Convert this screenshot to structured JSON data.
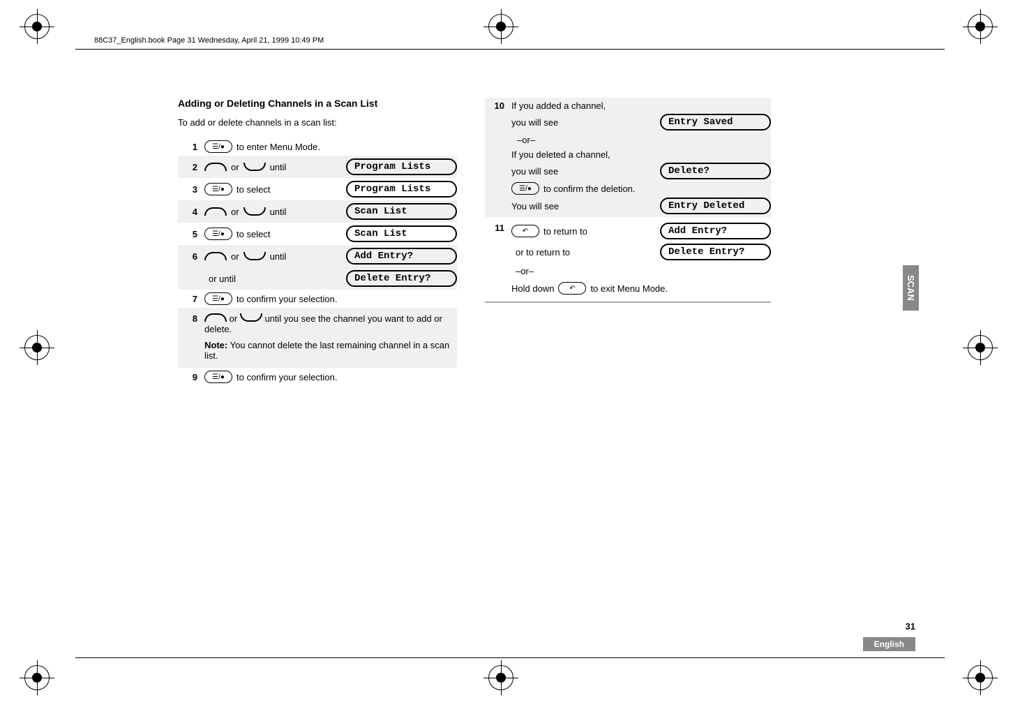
{
  "header": "88C37_English.book  Page 31  Wednesday, April 21, 1999  10:49 PM",
  "section": {
    "title": "Adding or Deleting Channels in a Scan List",
    "intro": "To add or delete channels in a scan list:"
  },
  "left_steps": {
    "s1": {
      "num": "1",
      "text": "to enter Menu Mode."
    },
    "s2": {
      "num": "2",
      "text_mid": "or",
      "text_until": "until",
      "display": "Program Lists"
    },
    "s3": {
      "num": "3",
      "text": "to select",
      "display": "Program Lists"
    },
    "s4": {
      "num": "4",
      "text_mid": "or",
      "text_until": "until",
      "display": "Scan List"
    },
    "s5": {
      "num": "5",
      "text": "to select",
      "display": "Scan List"
    },
    "s6": {
      "num": "6",
      "text_mid": "or",
      "text_until": "until",
      "display": "Add Entry?",
      "or_until": "or until",
      "display2": "Delete Entry?"
    },
    "s7": {
      "num": "7",
      "text": "to confirm your selection."
    },
    "s8": {
      "num": "8",
      "text_mid": "or",
      "text_until": "until you see the channel you want to add or delete.",
      "note_label": "Note:",
      "note_text": " You cannot delete the last remaining channel in a scan list."
    },
    "s9": {
      "num": "9",
      "text": "to confirm your selection."
    }
  },
  "right_steps": {
    "s10": {
      "num": "10",
      "line1": "If you added a channel,",
      "line2": "you will see",
      "display1": "Entry Saved",
      "or": "–or–",
      "line3": "If you deleted a channel,",
      "line4": "you will see",
      "display2": "Delete?",
      "line5": "to confirm the deletion.",
      "line6": "You will see",
      "display3": "Entry Deleted"
    },
    "s11": {
      "num": "11",
      "line1": "to return to",
      "display1": "Add Entry?",
      "line2": "or to return to",
      "display2": "Delete Entry?",
      "or": "–or–",
      "line3a": "Hold down",
      "line3b": "to exit Menu Mode."
    }
  },
  "tab": "SCAN",
  "page_number": "31",
  "language": "English"
}
